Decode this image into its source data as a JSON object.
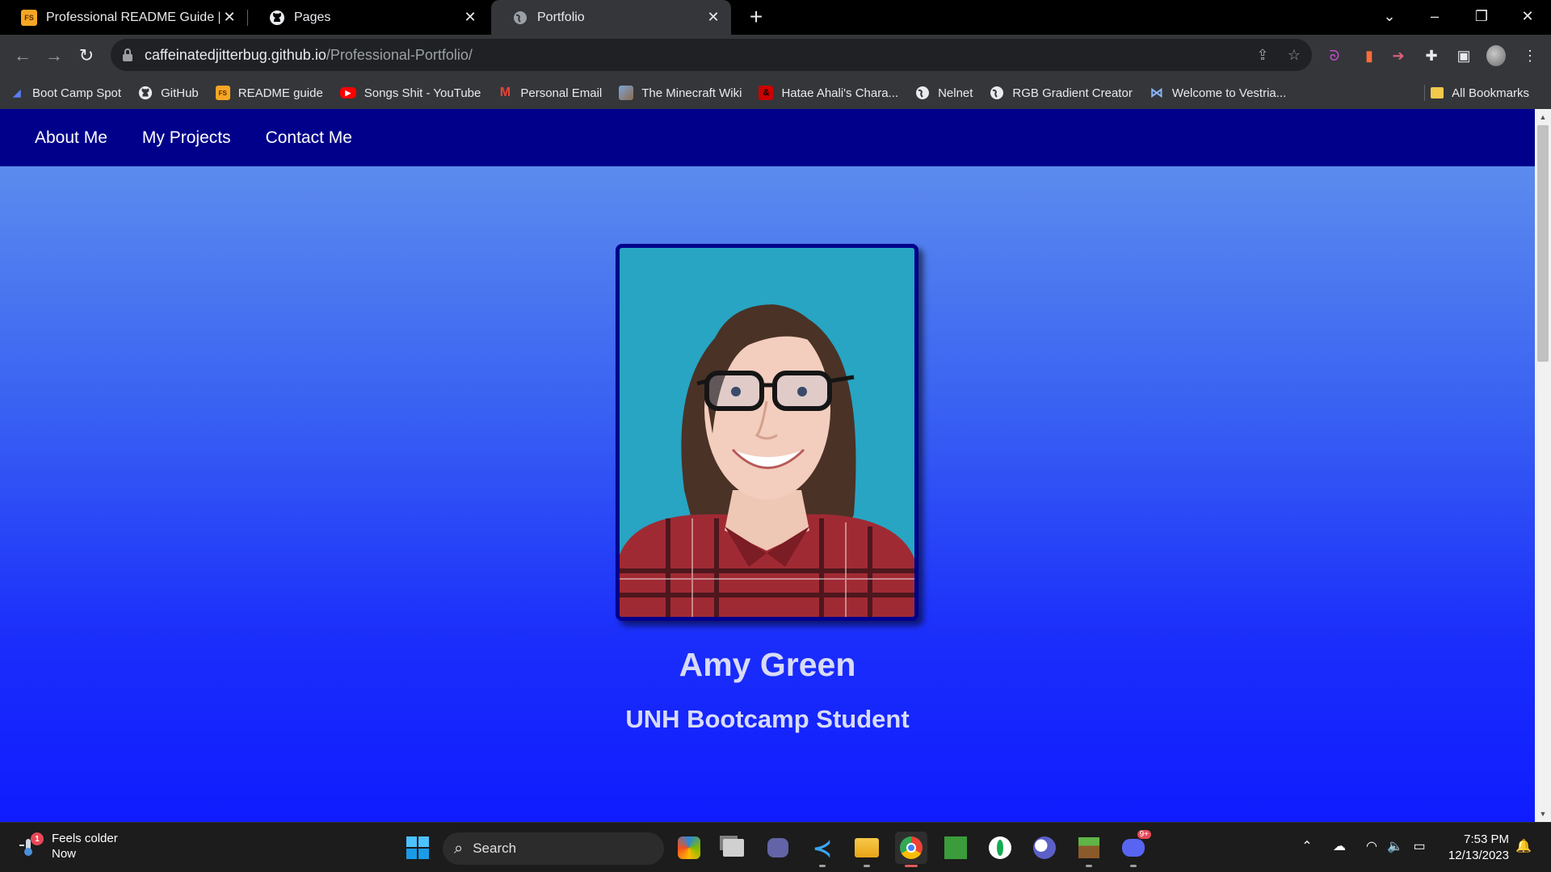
{
  "browser": {
    "tabs": [
      {
        "title": "Professional README Guide | Th",
        "favicon": "fs-logo-icon",
        "active": false
      },
      {
        "title": "Pages",
        "favicon": "github-icon",
        "active": false
      },
      {
        "title": "Portfolio",
        "favicon": "globe-icon",
        "active": true
      }
    ],
    "url": {
      "host": "caffeinatedjitterbug.github.io",
      "path": "/Professional-Portfolio/"
    },
    "bookmarks": [
      {
        "label": "Boot Camp Spot",
        "icon": "bootcamp-icon"
      },
      {
        "label": "GitHub",
        "icon": "github-icon"
      },
      {
        "label": "README guide",
        "icon": "fs-logo-icon"
      },
      {
        "label": "Songs Shit - YouTube",
        "icon": "youtube-icon"
      },
      {
        "label": "Personal Email",
        "icon": "gmail-icon"
      },
      {
        "label": "The Minecraft Wiki",
        "icon": "minecraft-wiki-icon"
      },
      {
        "label": "Hatae Ahali's Chara...",
        "icon": "dnd-icon"
      },
      {
        "label": "Nelnet",
        "icon": "globe-icon"
      },
      {
        "label": "RGB Gradient Creator",
        "icon": "globe-icon"
      },
      {
        "label": "Welcome to Vestria...",
        "icon": "vestria-icon"
      }
    ],
    "all_bookmarks": "All Bookmarks"
  },
  "site": {
    "nav": [
      "About Me",
      "My Projects",
      "Contact Me"
    ],
    "name": "Amy Green",
    "role": "UNH Bootcamp Student",
    "colors": {
      "nav_bg": "#00008b",
      "gradient_top": "#6495ed",
      "gradient_bottom": "#0f1cff",
      "border": "#00008b"
    }
  },
  "taskbar": {
    "weather": {
      "line1": "Feels colder",
      "line2": "Now",
      "badge": "1"
    },
    "search_placeholder": "Search",
    "discord_badge": "9+",
    "time": "7:53 PM",
    "date": "12/13/2023"
  }
}
